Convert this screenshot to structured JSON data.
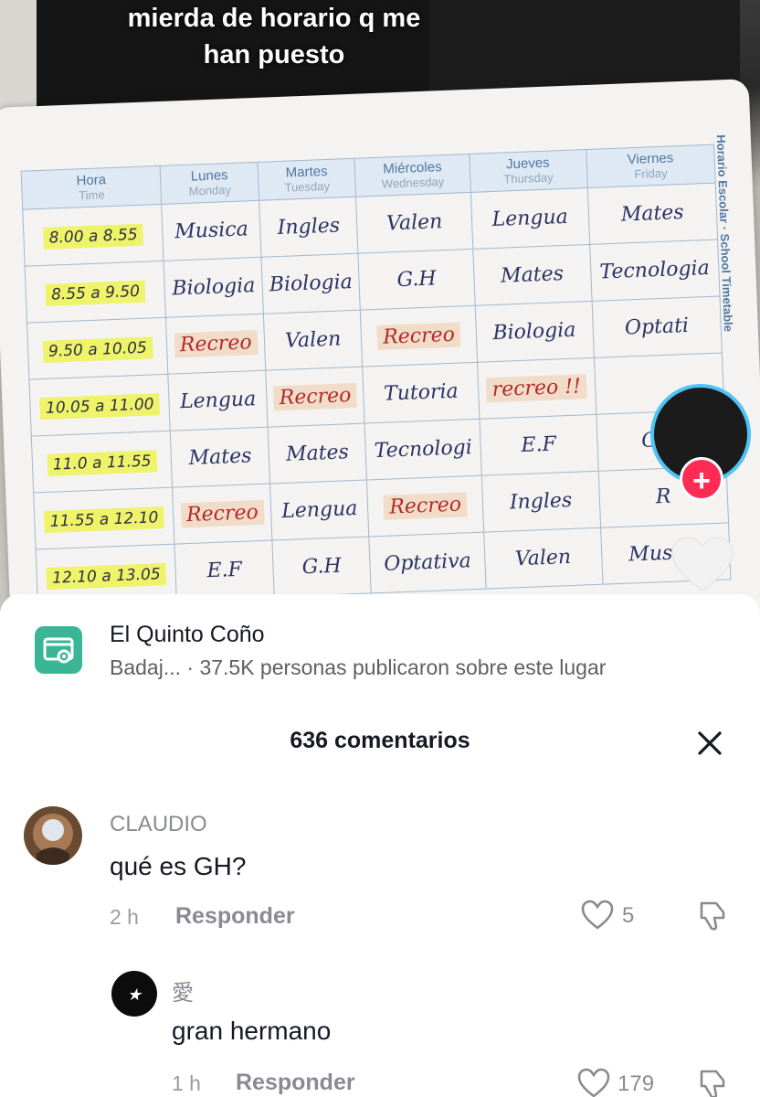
{
  "video": {
    "caption_line1": "mierda de horario q me",
    "caption_line2": "han puesto",
    "timetable": {
      "side_label": "Horario Escolar · School Timetable",
      "headers": [
        {
          "es": "Hora",
          "en": "Time"
        },
        {
          "es": "Lunes",
          "en": "Monday"
        },
        {
          "es": "Martes",
          "en": "Tuesday"
        },
        {
          "es": "Miércoles",
          "en": "Wednesday"
        },
        {
          "es": "Jueves",
          "en": "Thursday"
        },
        {
          "es": "Viernes",
          "en": "Friday"
        }
      ],
      "rows": [
        {
          "hour": "8.00 a 8.55",
          "cells": [
            "Musica",
            "Ingles",
            "Valen",
            "Lengua",
            "Mates"
          ]
        },
        {
          "hour": "8.55 a 9.50",
          "cells": [
            "Biologia",
            "Biologia",
            "G.H",
            "Mates",
            "Tecnologia"
          ]
        },
        {
          "hour": "9.50 a 10.05",
          "cells": [
            "Recreo",
            "Valen",
            "Recreo",
            "Biologia",
            "Optati"
          ]
        },
        {
          "hour": "10.05 a 11.00",
          "cells": [
            "Lengua",
            "Recreo",
            "Tutoria",
            "recreo !!",
            ""
          ]
        },
        {
          "hour": "11.0 a 11.55",
          "cells": [
            "Mates",
            "Mates",
            "Tecnologi",
            "E.F",
            "G.H"
          ]
        },
        {
          "hour": "11.55 a 12.10",
          "cells": [
            "Recreo",
            "Lengua",
            "Recreo",
            "Ingles",
            "R"
          ]
        },
        {
          "hour": "12.10 a 13.05",
          "cells": [
            "E.F",
            "G.H",
            "Optativa",
            "Valen",
            "Musica"
          ]
        }
      ],
      "red_cells": [
        "Recreo",
        "recreo !!"
      ]
    }
  },
  "place": {
    "name": "El Quinto Coño",
    "location": "Badaj...",
    "subtitle": "· 37.5K personas publicaron sobre este lugar"
  },
  "comments_header": {
    "count_label": "636 comentarios"
  },
  "comments": [
    {
      "username": "CLAUDIO",
      "text": "qué es GH?",
      "time": "2 h",
      "reply_label": "Responder",
      "likes": "5"
    },
    {
      "username": "愛",
      "text": "gran hermano",
      "time": "1 h",
      "reply_label": "Responder",
      "likes": "179"
    }
  ],
  "colors": {
    "accent": "#fe2c55",
    "place_icon": "#3ab697",
    "highlight": "#eef36a"
  }
}
